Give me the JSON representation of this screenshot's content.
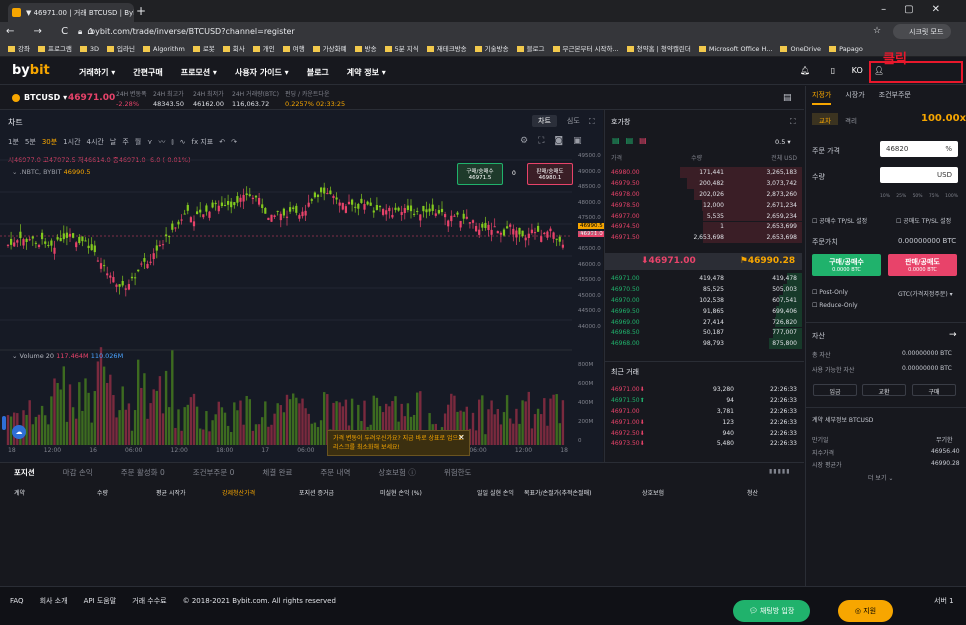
{
  "browser": {
    "tab_title": "▼ 46971.00 | 거래 BTCUSD | Bybit",
    "new_tab": "+",
    "url": "bybit.com/trade/inverse/BTCUSD?channel=register",
    "profile": "시크릿 모드",
    "nav": "← → C ⌂",
    "bookmarks": [
      "강좌",
      "프로그램",
      "3D",
      "입라닌",
      "Algorithm",
      "로봇",
      "회사",
      "개인",
      "여행",
      "가상화폐",
      "방송",
      "5분 지식",
      "재테크방송",
      "기술방송",
      "블로그",
      "무근본부터 시작하...",
      "청약홈 | 청약캘린더",
      "Microsoft Office H...",
      "OneDrive",
      "Papago"
    ]
  },
  "header": {
    "logo_a": "by",
    "logo_b": "bit",
    "nav": [
      "거래하기 ▾",
      "간편구매",
      "프로모션 ▾",
      "사용자 가이드 ▾",
      "블로그",
      "계약 정보 ▾"
    ],
    "lang": "KO",
    "click_annotation": "클릭"
  },
  "ticker": {
    "symbol": "BTCUSD ▾",
    "price": "46971.00",
    "stats": [
      {
        "label": "24H 변동폭",
        "value": "-2.28%",
        "color": "#e8436a"
      },
      {
        "label": "24H 최고가",
        "value": "48343.50"
      },
      {
        "label": "24H 최저가",
        "value": "46162.00"
      },
      {
        "label": "24H 거래량(BTC)",
        "value": "116,063.72"
      },
      {
        "label": "펀딩 / 카운트다운",
        "value": "0.2257%  02:33:25",
        "color": "#f7a600"
      }
    ]
  },
  "chart": {
    "title": "차트",
    "tabs": [
      "차트",
      "심도"
    ],
    "tools": [
      "1분",
      "5분",
      "30분",
      "1시간",
      "4시간",
      "날",
      "주",
      "월",
      "⋎",
      "〰",
      "⫾",
      "∿",
      "fx 지표",
      "↶",
      "↷"
    ],
    "ohlc": "시46977.0 고47072.5 저46614.0 종46971.0 -6.0 (-0.01%)",
    "series": ".NBTC, BYBIT",
    "series_val": "46990.5",
    "buy_label": "구매/숭매수",
    "buy_price": "46971.5",
    "spread": "0",
    "sell_label": "판매/숭매도",
    "sell_price": "46980.1",
    "volume": "Volume 20",
    "vol_a": "117.464M",
    "vol_b": "110.026M",
    "y_price": [
      "49500.0",
      "49000.0",
      "48500.0",
      "48000.0",
      "47500.0",
      "47000.0",
      "46500.0",
      "46000.0",
      "45500.0",
      "45000.0",
      "44500.0",
      "44000.0"
    ],
    "y_volume": [
      "800M",
      "600M",
      "400M",
      "200M",
      "0"
    ],
    "x_labels": [
      "18",
      "12:00",
      "16",
      "06:00",
      "12:00",
      "18:00",
      "17",
      "06:00",
      "12:00",
      "18:00",
      "18",
      "06:00",
      "12:00",
      "18"
    ],
    "price_tag_a": "46990.5",
    "price_tag_b": "46971.0",
    "notice": "가격 변동이 두려우신가요? 지금 바로 상표로 업으로 리스크를 최소화해 보세요!"
  },
  "chart_data": {
    "type": "bar",
    "title": "Volume 20",
    "x": [
      "18",
      "12:00",
      "16",
      "06:00",
      "12:00",
      "18:00",
      "17",
      "06:00",
      "12:00",
      "18:00",
      "18",
      "06:00",
      "12:00",
      "18"
    ],
    "ylabel": "",
    "ylim": [
      0,
      800
    ],
    "unit": "M"
  },
  "orderbook": {
    "title": "호가창",
    "step": "0.5 ▾",
    "headers": [
      "가격",
      "수량",
      "전체 USD"
    ],
    "asks": [
      {
        "p": "46980.00",
        "q": "171,441",
        "t": "3,265,183",
        "d": 0.95
      },
      {
        "p": "46979.50",
        "q": "200,482",
        "t": "3,073,742",
        "d": 0.9
      },
      {
        "p": "46978.00",
        "q": "202,026",
        "t": "2,873,260",
        "d": 0.84
      },
      {
        "p": "46978.50",
        "q": "12,000",
        "t": "2,671,234",
        "d": 0.78
      },
      {
        "p": "46977.00",
        "q": "5,535",
        "t": "2,659,234",
        "d": 0.77
      },
      {
        "p": "46974.50",
        "q": "1",
        "t": "2,653,699",
        "d": 0.77
      },
      {
        "p": "46971.50",
        "q": "2,653,698",
        "t": "2,653,698",
        "d": 0.77
      }
    ],
    "last": "⬇46971.00",
    "mark": "⚑46990.28",
    "bids": [
      {
        "p": "46971.00",
        "q": "419,478",
        "t": "419,478",
        "d": 0.12
      },
      {
        "p": "46970.50",
        "q": "85,525",
        "t": "505,003",
        "d": 0.15
      },
      {
        "p": "46970.00",
        "q": "102,538",
        "t": "607,541",
        "d": 0.18
      },
      {
        "p": "46969.50",
        "q": "91,865",
        "t": "699,406",
        "d": 0.2
      },
      {
        "p": "46969.00",
        "q": "27,414",
        "t": "726,820",
        "d": 0.21
      },
      {
        "p": "46968.50",
        "q": "50,187",
        "t": "777,007",
        "d": 0.23
      },
      {
        "p": "46968.00",
        "q": "98,793",
        "t": "875,800",
        "d": 0.26
      }
    ],
    "recent_title": "최근 거래",
    "trades": [
      {
        "p": "46971.00⬇",
        "q": "93,280",
        "t": "22:26:33",
        "c": "#e8436a"
      },
      {
        "p": "46971.50⬆",
        "q": "94",
        "t": "22:26:33",
        "c": "#20b26c"
      },
      {
        "p": "46971.00",
        "q": "3,781",
        "t": "22:26:33",
        "c": "#e8436a"
      },
      {
        "p": "46971.00⬇",
        "q": "123",
        "t": "22:26:33",
        "c": "#e8436a"
      },
      {
        "p": "46972.50⬇",
        "q": "940",
        "t": "22:26:33",
        "c": "#e8436a"
      },
      {
        "p": "46973.50⬇",
        "q": "5,480",
        "t": "22:26:33",
        "c": "#e8436a"
      }
    ]
  },
  "order": {
    "tabs": [
      "지정가",
      "시장가",
      "조건부주문"
    ],
    "mode_a": "교차",
    "mode_b": "격리",
    "leverage": "100.00x",
    "price_label": "주문 가격",
    "price_val": "46820",
    "qty_label": "수량",
    "qty_unit": "USD",
    "pcts": [
      "10%",
      "25%",
      "50%",
      "75%",
      "100%"
    ],
    "tpsl_buy": "공매수 TP/SL 설정",
    "tpsl_sell": "공매도 TP/SL 설정",
    "cost_label": "주문가치",
    "cost_val": "0.00000000 BTC",
    "buy_btn": "구매/공매수",
    "buy_sub": "0.0000 BTC",
    "sell_btn": "판매/공매도",
    "sell_sub": "0.0000 BTC",
    "post_only": "Post-Only",
    "gtc": "GTC(가격지정주문) ▾",
    "reduce_only": "Reduce-Only",
    "assets_title": "자산",
    "equity_label": "총 자산",
    "equity_val": "0.00000000 BTC",
    "avail_label": "사용 가능한 자산",
    "avail_val": "0.00000000 BTC",
    "btns": [
      "입금",
      "교환",
      "구매"
    ],
    "detail_title": "계약 세부정보 BTCUSD",
    "d1_l": "만기일",
    "d1_v": "무기한",
    "d2_l": "지수가격",
    "d2_v": "46956.40",
    "d3_l": "시장 평균가",
    "d3_v": "46990.28",
    "more": "더 보기 ⌄"
  },
  "bottom": {
    "tabs": [
      "포지션",
      "마감 손익",
      "주문 활성화 0",
      "조건부주문 0",
      "체결 완료",
      "주문 내역",
      "상호보험 ⓘ",
      "위험한도"
    ],
    "cols": [
      "계약",
      "수량",
      "평균 시작가",
      "강제청산가격",
      "포지션 증거금",
      "미실현 손익 (%)",
      "일일 실현 손익",
      "목표가/손절가(추적손절매)",
      "상호보험",
      "청산"
    ]
  },
  "footer": {
    "links": [
      "FAQ",
      "회사 소개",
      "API 도움말",
      "거래 수수료"
    ],
    "copy": "© 2018-2021 Bybit.com. All rights reserved",
    "chat": "채팅방 입장",
    "help": "지원",
    "server": "서버 1"
  }
}
